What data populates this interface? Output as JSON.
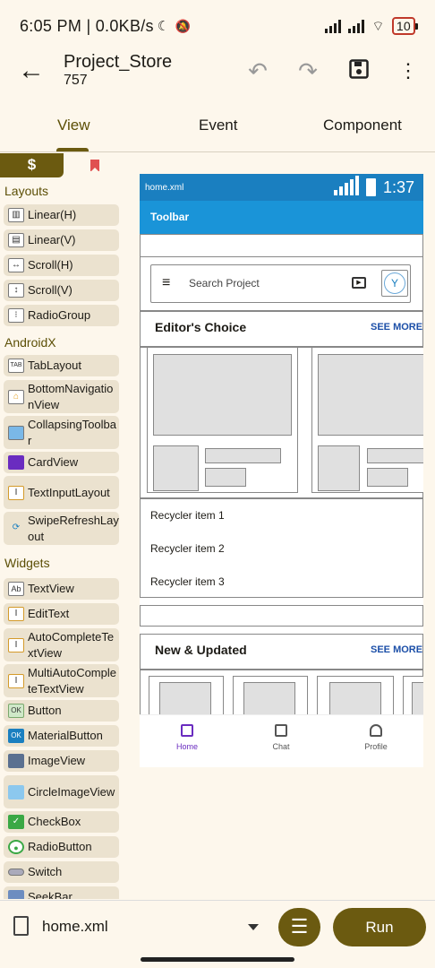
{
  "status_bar": {
    "time": "6:05 PM",
    "speed": "0.0KB/s",
    "battery": "10"
  },
  "app_bar": {
    "title": "Project_Store",
    "subtitle": "757"
  },
  "tabs": [
    {
      "label": "View"
    },
    {
      "label": "Event"
    },
    {
      "label": "Component"
    }
  ],
  "palette": {
    "header_symbol": "$",
    "categories": [
      "Layouts",
      "AndroidX",
      "Widgets"
    ],
    "items": [
      {
        "label": "Linear(H)",
        "icon": "linear-h-icon"
      },
      {
        "label": "Linear(V)",
        "icon": "linear-v-icon"
      },
      {
        "label": "Scroll(H)",
        "icon": "scroll-h-icon"
      },
      {
        "label": "Scroll(V)",
        "icon": "scroll-v-icon"
      },
      {
        "label": "RadioGroup",
        "icon": "radiogroup-icon"
      },
      {
        "label": "TabLayout",
        "icon": "tablayout-icon"
      },
      {
        "label": "BottomNavigationView",
        "icon": "bottomnav-icon"
      },
      {
        "label": "CollapsingToolbar",
        "icon": "collapsing-toolbar-icon"
      },
      {
        "label": "CardView",
        "icon": "cardview-icon"
      },
      {
        "label": "TextInputLayout",
        "icon": "textinputlayout-icon"
      },
      {
        "label": "SwipeRefreshLayout",
        "icon": "swiperefresh-icon"
      },
      {
        "label": "TextView",
        "icon": "textview-icon"
      },
      {
        "label": "EditText",
        "icon": "edittext-icon"
      },
      {
        "label": "AutoCompleteTextView",
        "icon": "autocomplete-icon"
      },
      {
        "label": "MultiAutoCompleteTextView",
        "icon": "multiautocomplete-icon"
      },
      {
        "label": "Button",
        "icon": "button-icon"
      },
      {
        "label": "MaterialButton",
        "icon": "materialbutton-icon"
      },
      {
        "label": "ImageView",
        "icon": "imageview-icon"
      },
      {
        "label": "CircleImageView",
        "icon": "circleimageview-icon"
      },
      {
        "label": "CheckBox",
        "icon": "checkbox-icon"
      },
      {
        "label": "RadioButton",
        "icon": "radiobutton-icon"
      },
      {
        "label": "Switch",
        "icon": "switch-icon"
      },
      {
        "label": "SeekBar",
        "icon": "seekbar-icon"
      }
    ]
  },
  "preview": {
    "filename": "home.xml",
    "clock": "1:37",
    "toolbar": "Toolbar",
    "search_placeholder": "Search Project",
    "section1": "Editor's Choice",
    "section2": "New & Updated",
    "see_more": "SEE MORE",
    "recycler_items": [
      "Recycler item 1",
      "Recycler item 2",
      "Recycler item 3"
    ],
    "nav": [
      "Home",
      "Chat",
      "Profile"
    ]
  },
  "bottom_bar": {
    "file": "home.xml",
    "run_label": "Run"
  },
  "colors": {
    "accent": "#6b5a10",
    "preview_blue": "#1a94d8",
    "background": "#fdf7ec"
  }
}
